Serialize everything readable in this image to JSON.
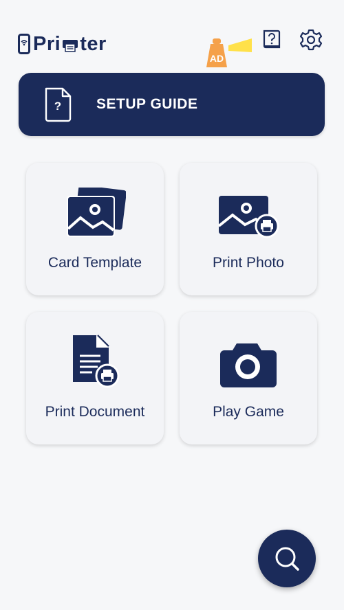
{
  "header": {
    "logo_text_left": "Pri",
    "logo_text_right": "ter",
    "ad_label": "AD",
    "help_icon": "help-book-icon",
    "settings_icon": "gear-icon"
  },
  "setup_guide": {
    "label": "SETUP GUIDE",
    "icon": "help-document-icon"
  },
  "features": [
    {
      "label": "Card Template",
      "icon": "photos-stack-icon"
    },
    {
      "label": "Print Photo",
      "icon": "photo-print-icon"
    },
    {
      "label": "Print Document",
      "icon": "document-print-icon"
    },
    {
      "label": "Play Game",
      "icon": "camera-icon"
    }
  ],
  "fab": {
    "icon": "search-icon"
  },
  "colors": {
    "primary": "#1b2b5a",
    "background": "#f6f7f9",
    "card": "#f3f4f7",
    "ad_orange": "#f5a14a",
    "ad_yellow": "#ffe14a"
  }
}
